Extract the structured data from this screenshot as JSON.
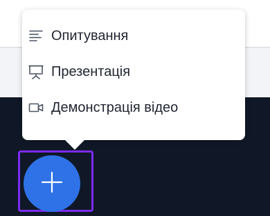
{
  "menu": {
    "items": [
      {
        "label": "Опитування",
        "icon": "poll-icon"
      },
      {
        "label": "Презентація",
        "icon": "presentation-icon"
      },
      {
        "label": "Демонстрація відео",
        "icon": "video-icon"
      }
    ]
  },
  "actions_button": {
    "icon": "plus-icon",
    "color": "#2f72e7",
    "focus_outline_color": "#7b2cf3"
  },
  "colors": {
    "menu_text": "#1f2430",
    "icon_stroke": "#4a5563",
    "dark_background": "#101827"
  }
}
